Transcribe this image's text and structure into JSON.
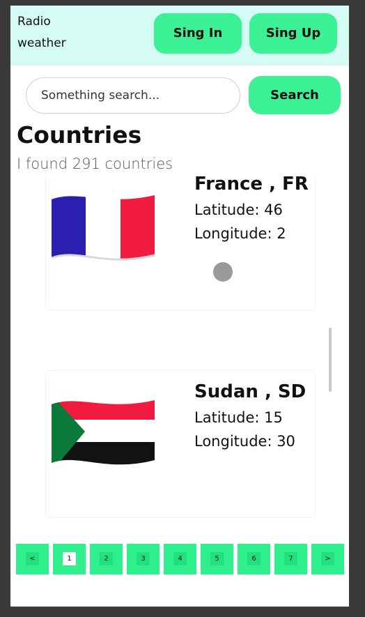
{
  "header": {
    "brand_line1": "Radio",
    "brand_line2": "weather",
    "signin_label": "Sing In",
    "signup_label": "Sing Up"
  },
  "search": {
    "placeholder": "Something search...",
    "button_label": "Search"
  },
  "main": {
    "title": "Countries",
    "subtitle": "I found 291 countries"
  },
  "countries": [
    {
      "name": "France , FR",
      "latitude": "Latitude: 46",
      "longitude": "Longitude: 2",
      "flag_icon": "france-flag-icon"
    },
    {
      "name": "Sudan , SD",
      "latitude": "Latitude: 15",
      "longitude": "Longitude: 30",
      "flag_icon": "sudan-flag-icon"
    }
  ],
  "pagination": {
    "prev": "<",
    "next": ">",
    "pages": [
      "1",
      "2",
      "3",
      "4",
      "5",
      "6",
      "7"
    ],
    "current": "1"
  },
  "colors": {
    "accent": "#3bf095",
    "header_bg": "#d4fbf4",
    "pager_bg": "#2ff08c"
  }
}
